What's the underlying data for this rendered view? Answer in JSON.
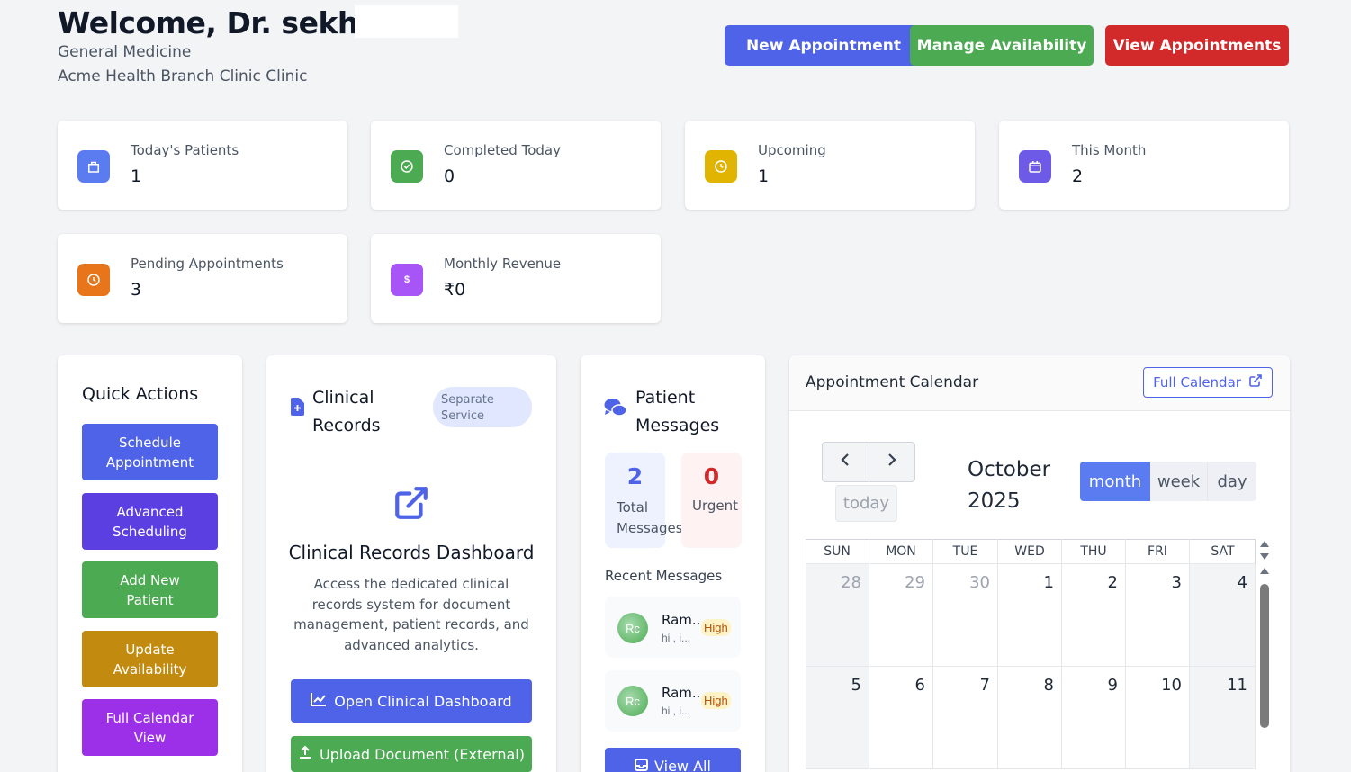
{
  "header": {
    "welcome": "Welcome, Dr. sekhar",
    "specialty": "General Medicine",
    "clinic": "Acme Health Branch Clinic Clinic",
    "buttons": {
      "new_appointment": "New Appointment",
      "manage_availability": "Manage Availability",
      "view_appointments": "View Appointments"
    }
  },
  "stats": [
    {
      "label": "Today's Patients",
      "value": "1",
      "icon": "bag-icon",
      "color": "#5b7cf0"
    },
    {
      "label": "Completed Today",
      "value": "0",
      "icon": "check-circle-icon",
      "color": "#4caa52"
    },
    {
      "label": "Upcoming",
      "value": "1",
      "icon": "clock-icon",
      "color": "#e0b400"
    },
    {
      "label": "This Month",
      "value": "2",
      "icon": "calendar-icon",
      "color": "#6d5be8"
    },
    {
      "label": "Pending Appointments",
      "value": "3",
      "icon": "clock-icon",
      "color": "#e8751a"
    },
    {
      "label": "Monthly Revenue",
      "value": "₹0",
      "icon": "dollar-icon",
      "color": "#a855f7"
    }
  ],
  "quick_actions": {
    "title": "Quick Actions",
    "items": [
      {
        "label": "Schedule Appointment",
        "color": "#4f63e8"
      },
      {
        "label": "Advanced Scheduling",
        "color": "#5b3fe0"
      },
      {
        "label": "Add New Patient",
        "color": "#4caa52"
      },
      {
        "label": "Update Availability",
        "color": "#c28a0f"
      },
      {
        "label": "Full Calendar View",
        "color": "#9b30e8"
      }
    ]
  },
  "clinical": {
    "title": "Clinical Records",
    "badge": "Separate Service",
    "dashboard_title": "Clinical Records Dashboard",
    "description": "Access the dedicated clinical records system for document management, patient records, and advanced analytics.",
    "open_button": "Open Clinical Dashboard",
    "upload_button": "Upload Document (External)"
  },
  "messages": {
    "title": "Patient Messages",
    "total_value": "2",
    "total_label": "Total Messages",
    "urgent_value": "0",
    "urgent_label": "Urgent",
    "recent_title": "Recent Messages",
    "items": [
      {
        "initials": "Rc",
        "name": "Ram...",
        "preview": "hi , i...",
        "priority": "High"
      },
      {
        "initials": "Rc",
        "name": "Ram...",
        "preview": "hi , i...",
        "priority": "High"
      }
    ],
    "view_all": "View All"
  },
  "calendar": {
    "title": "Appointment Calendar",
    "full_calendar": "Full Calendar",
    "today": "today",
    "month_label": "October",
    "year_label": "2025",
    "views": [
      "month",
      "week",
      "day"
    ],
    "active_view": "month",
    "weekdays": [
      "SUN",
      "MON",
      "TUE",
      "WED",
      "THU",
      "FRI",
      "SAT"
    ],
    "weeks": [
      [
        {
          "d": "28",
          "muted": true
        },
        {
          "d": "29",
          "muted": true
        },
        {
          "d": "30",
          "muted": true
        },
        {
          "d": "1"
        },
        {
          "d": "2"
        },
        {
          "d": "3"
        },
        {
          "d": "4"
        }
      ],
      [
        {
          "d": "5"
        },
        {
          "d": "6"
        },
        {
          "d": "7"
        },
        {
          "d": "8"
        },
        {
          "d": "9"
        },
        {
          "d": "10"
        },
        {
          "d": "11"
        }
      ]
    ]
  }
}
